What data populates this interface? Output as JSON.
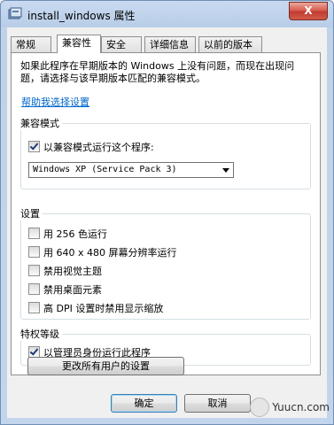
{
  "window": {
    "title": "install_windows 属性",
    "close_glyph": "X"
  },
  "tabs": [
    {
      "label": "常规"
    },
    {
      "label": "兼容性"
    },
    {
      "label": "安全"
    },
    {
      "label": "详细信息"
    },
    {
      "label": "以前的版本"
    }
  ],
  "intro_text": "如果此程序在早期版本的 Windows 上没有问题，而现在出现问题，请选择与该早期版本匹配的兼容模式。",
  "help_link": "帮助我选择设置",
  "compat_mode": {
    "title": "兼容模式",
    "checkbox_label": "以兼容模式运行这个程序:",
    "checked": true,
    "selected_os": "Windows XP (Service Pack 3)"
  },
  "settings": {
    "title": "设置",
    "items": [
      {
        "label": "用 256 色运行",
        "checked": false
      },
      {
        "label": "用 640 x 480 屏幕分辨率运行",
        "checked": false
      },
      {
        "label": "禁用视觉主题",
        "checked": false
      },
      {
        "label": "禁用桌面元素",
        "checked": false
      },
      {
        "label": "高 DPI 设置时禁用显示缩放",
        "checked": false
      }
    ]
  },
  "privilege": {
    "title": "特权等级",
    "checkbox_label": "以管理员身份运行此程序",
    "checked": true
  },
  "change_all_button": "更改所有用户的设置",
  "ok_button": "确定",
  "cancel_button": "取消",
  "watermark": "Yuucn.com"
}
